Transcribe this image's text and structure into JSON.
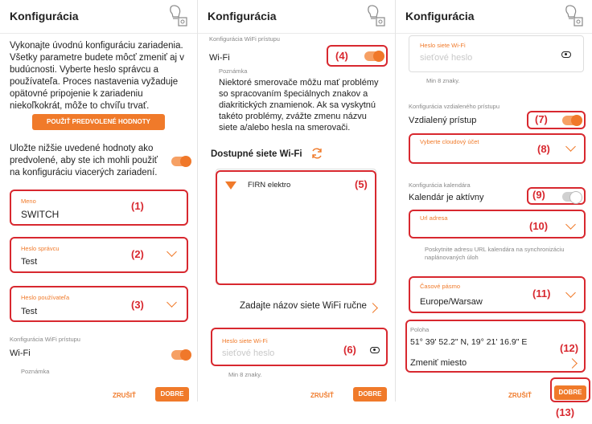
{
  "header": {
    "title": "Konfigurácia"
  },
  "panel1": {
    "intro": "Vykonajte úvodnú konfiguráciu zariadenia. Všetky parametre budete môcť zmeniť aj v budúcnosti. Vyberte heslo správcu a používateľa. Proces nastavenia vyžaduje opätovné pripojenie k zariadeniu niekoľkokrát, môže to chvíľu trvať.",
    "defaults_button": "POUŽIŤ PREDVOLENÉ HODNOTY",
    "save_text": "Uložte nižšie uvedené hodnoty ako predvolené, aby ste ich mohli použiť na konfiguráciu viacerých zariadení.",
    "name_label": "Meno",
    "name_value": "SWITCH",
    "admin_label": "Heslo správcu",
    "admin_value": "Test",
    "user_label": "Heslo používateľa",
    "user_value": "Test",
    "wifi_section": "Konfigurácia WiFi prístupu",
    "wifi_label": "Wi-Fi",
    "note_label": "Poznámka",
    "callouts": [
      "(1)",
      "(2)",
      "(3)"
    ]
  },
  "panel2": {
    "section": "Konfigurácia WiFi prístupu",
    "wifi_label": "Wi-Fi",
    "note_label": "Poznámka",
    "note_text": "Niektoré smerovače môžu mať problémy so spracovaním špeciálnych znakov a diakritických znamienok. Ak sa vyskytnú takéto problémy, zvážte zmenu názvu siete a/alebo hesla na smerovači.",
    "available": "Dostupné siete Wi-Fi",
    "network": "FIRN elektro",
    "manual": "Zadajte názov siete WiFi ručne",
    "pwd_label": "Heslo siete Wi-Fi",
    "pwd_placeholder": "sieťové heslo",
    "min_chars": "Min 8 znaky.",
    "callouts": [
      "(4)",
      "(5)",
      "(6)"
    ]
  },
  "panel3": {
    "pwd_label": "Heslo siete Wi-Fi",
    "pwd_placeholder": "sieťové heslo",
    "min_chars": "Min 8 znaky.",
    "remote_section": "Konfigurácia vzdialeného prístupu",
    "remote_label": "Vzdialený prístup",
    "cloud_label": "Vyberte cloudový účet",
    "calendar_section": "Konfigurácia kalendára",
    "calendar_label": "Kalendár je aktívny",
    "url_label": "Url adresa",
    "url_help": "Poskytnite adresu URL kalendára na synchronizáciu naplánovaných úloh",
    "tz_label": "Časové pásmo",
    "tz_value": "Europe/Warsaw",
    "loc_label": "Poloha",
    "loc_value": "51° 39' 52.2\" N, 19° 21' 16.9\" E",
    "change_loc": "Zmeniť miesto",
    "callouts": [
      "(7)",
      "(8)",
      "(9)",
      "(10)",
      "(11)",
      "(12)",
      "(13)"
    ]
  },
  "footer": {
    "cancel": "ZRUŠIŤ",
    "ok": "DOBRE"
  },
  "colors": {
    "accent": "#f07a2a",
    "callout": "#d8282f"
  }
}
